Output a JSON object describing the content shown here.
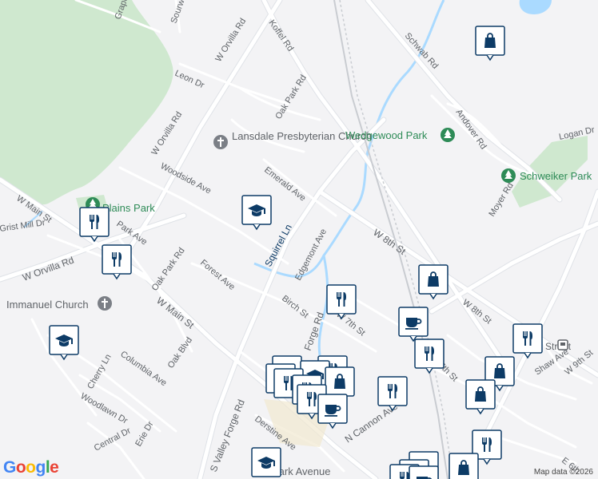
{
  "map": {
    "attribution": "Map data ©2026",
    "logo": "Google",
    "colors": {
      "land": "#f3f3f5",
      "road": "#ffffff",
      "road_stroke": "#d9dde3",
      "park": "#c8e6c9",
      "water": "#aadaff",
      "marker": "#0d3b66"
    },
    "roads": [
      "Grapevine",
      "Sourwood",
      "Koffel Rd",
      "W Orvilla Rd",
      "Leon Dr",
      "W Orvilla Rd",
      "Oak Park Rd",
      "Schwab Rd",
      "Andover Rd",
      "Logan Dr",
      "Woodside Ave",
      "Emerald Ave",
      "Moyer Rd",
      "Squirrel Ln",
      "Grist Mill Dr",
      "Park Ave",
      "W Orvilla Rd",
      "Edgemont Ave",
      "W 8th St",
      "Oak Park Rd",
      "Forest Ave",
      "W Main St",
      "Birch St",
      "W 7th St",
      "Forge Rd",
      "W 8th St",
      "Columbia Ave",
      "Oak Blvd",
      "Cherry Ln",
      "Woodlawn Dr",
      "Erie Dr",
      "Central Dr",
      "S Valley Forge Rd",
      "Derstine Ave",
      "N Cannon Ave",
      "7th St",
      "Shaw Ave",
      "W 9th St",
      "9th Street",
      "E 6th",
      "W Main St"
    ],
    "places": [
      {
        "name": "Lansdale Presbyterian Church",
        "icon": "church-icon"
      },
      {
        "name": "Wedgewood Park",
        "icon": "park-tree-icon"
      },
      {
        "name": "Schweiker Park",
        "icon": "park-tree-icon"
      },
      {
        "name": "Plains Park",
        "icon": "park-tree-icon"
      },
      {
        "name": "Immanuel Church",
        "icon": "church-icon"
      },
      {
        "name": "Park Avenue",
        "icon": "school-icon"
      }
    ],
    "markers": [
      {
        "type": "shopping",
        "icon": "shopping-bag-icon"
      },
      {
        "type": "school",
        "icon": "graduation-cap-icon"
      },
      {
        "type": "restaurant",
        "icon": "fork-knife-icon"
      },
      {
        "type": "restaurant",
        "icon": "fork-knife-icon"
      },
      {
        "type": "school",
        "icon": "graduation-cap-icon"
      },
      {
        "type": "restaurant",
        "icon": "fork-knife-icon"
      },
      {
        "type": "shopping",
        "icon": "shopping-bag-icon"
      },
      {
        "type": "cafe",
        "icon": "coffee-cup-icon"
      },
      {
        "type": "restaurant",
        "icon": "fork-knife-icon"
      },
      {
        "type": "restaurant",
        "icon": "fork-knife-icon"
      },
      {
        "type": "shopping",
        "icon": "shopping-bag-icon"
      },
      {
        "type": "shopping",
        "icon": "shopping-bag-icon"
      },
      {
        "type": "restaurant",
        "icon": "fork-knife-icon"
      },
      {
        "type": "cafe",
        "icon": "coffee-cup-icon"
      },
      {
        "type": "shopping",
        "icon": "shopping-bag-icon"
      },
      {
        "type": "restaurant",
        "icon": "fork-knife-icon"
      },
      {
        "type": "shopping",
        "icon": "shopping-bag-icon"
      },
      {
        "type": "school",
        "icon": "graduation-cap-icon"
      }
    ]
  }
}
